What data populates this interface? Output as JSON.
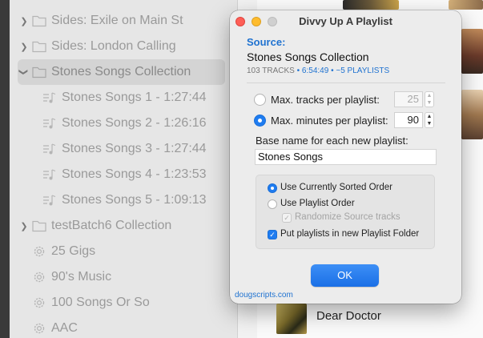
{
  "sidebar": {
    "items": [
      {
        "label": "Sides: Exile on Main St",
        "type": "folder",
        "expanded": false
      },
      {
        "label": "Sides: London Calling",
        "type": "folder",
        "expanded": false
      },
      {
        "label": "Stones Songs Collection",
        "type": "folder",
        "expanded": true,
        "selected": true
      },
      {
        "label": "Stones Songs 1 - 1:27:44",
        "type": "playlist"
      },
      {
        "label": "Stones Songs 2 - 1:26:16",
        "type": "playlist"
      },
      {
        "label": "Stones Songs 3 - 1:27:44",
        "type": "playlist"
      },
      {
        "label": "Stones Songs 4 - 1:23:53",
        "type": "playlist"
      },
      {
        "label": "Stones Songs 5 - 1:09:13",
        "type": "playlist"
      },
      {
        "label": "testBatch6 Collection",
        "type": "folder",
        "expanded": false
      },
      {
        "label": "25 Gigs",
        "type": "smart"
      },
      {
        "label": "90's Music",
        "type": "smart"
      },
      {
        "label": "100 Songs Or So",
        "type": "smart"
      },
      {
        "label": "AAC",
        "type": "smart"
      }
    ]
  },
  "track_list": {
    "visible_track": "Dear Doctor"
  },
  "dialog": {
    "title": "Divvy Up A Playlist",
    "source_label": "Source:",
    "source_name": "Stones Songs Collection",
    "stats": {
      "tracks": "103 TRACKS",
      "sep": "•",
      "duration": "6:54:49",
      "playlists": "~5 PLAYLISTS"
    },
    "max_tracks": {
      "label": "Max. tracks per playlist:",
      "value": "25",
      "selected": false
    },
    "max_minutes": {
      "label": "Max. minutes per playlist:",
      "value": "90",
      "selected": true
    },
    "base_name": {
      "label": "Base name for each new playlist:",
      "value": "Stones Songs"
    },
    "order": {
      "sorted": {
        "label": "Use Currently Sorted Order",
        "selected": true
      },
      "playlist": {
        "label": "Use Playlist Order",
        "selected": false
      },
      "randomize": {
        "label": "Randomize Source tracks",
        "checked": true,
        "enabled": false
      },
      "folder": {
        "label": "Put playlists in new Playlist Folder",
        "checked": true
      }
    },
    "ok_label": "OK",
    "footer_link": "dougscripts.com"
  },
  "colors": {
    "accent": "#1f7cf0",
    "link": "#1f72d0",
    "close": "#fe5f57",
    "minimize": "#febc2e"
  }
}
